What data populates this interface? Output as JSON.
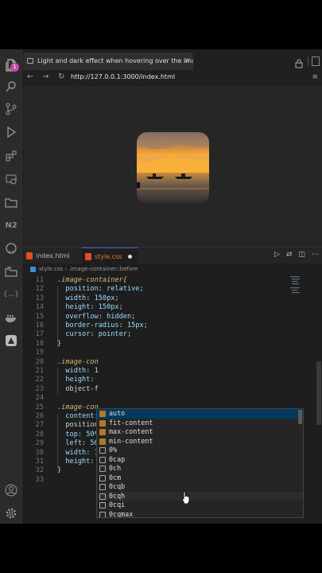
{
  "activity_bar": {
    "icons": [
      "explorer-icon",
      "search-icon",
      "source-control-icon",
      "run-debug-icon",
      "extensions-icon",
      "remote-explorer-icon",
      "folder-icon",
      "n2-icon",
      "github-icon",
      "folders-icon",
      "ellipsis-icon",
      "docker-icon",
      "azure-icon",
      "account-icon",
      "settings-icon"
    ],
    "badge": "1",
    "n2_label": "N2",
    "ellipsis_label": "{...}"
  },
  "browser": {
    "tab_title": "Light and dark effect when hovering over the image",
    "tab_close": "×",
    "url": "http://127.0.0.1:3000/index.html",
    "back": "←",
    "forward": "→",
    "reload": "↻",
    "menu": "≡"
  },
  "editor": {
    "tabs": [
      {
        "label": "index.html",
        "icon_color": "#e44d26",
        "active": false
      },
      {
        "label": "style.css",
        "icon_color": "#e44d26",
        "active": true,
        "dirty": true
      }
    ],
    "breadcrumb": {
      "file": "style.css",
      "separator": "›",
      "symbol": ".image-container::before"
    },
    "lines": [
      {
        "n": "11",
        "code": ".image-container{"
      },
      {
        "n": "12",
        "code": "  position: relative;"
      },
      {
        "n": "13",
        "code": "  width: 150px;"
      },
      {
        "n": "14",
        "code": "  height: 150px;"
      },
      {
        "n": "15",
        "code": "  overflow: hidden;"
      },
      {
        "n": "16",
        "code": "  border-radius: 15px;"
      },
      {
        "n": "17",
        "code": "  cursor: pointer;"
      },
      {
        "n": "18",
        "code": "}"
      },
      {
        "n": "19",
        "code": ""
      },
      {
        "n": "20",
        "code": ".image-con"
      },
      {
        "n": "21",
        "code": "  width: 1"
      },
      {
        "n": "22",
        "code": "  height: "
      },
      {
        "n": "23",
        "code": "  object-f"
      },
      {
        "n": "24",
        "code": ""
      },
      {
        "n": "25",
        "code": ".image-con"
      },
      {
        "n": "26",
        "code": "  content:"
      },
      {
        "n": "27",
        "code": "  position"
      },
      {
        "n": "28",
        "code": "  top: 50%"
      },
      {
        "n": "29",
        "code": "  left: 50"
      },
      {
        "n": "30",
        "code": "  width: 1"
      },
      {
        "n": "31",
        "code": "  height: ;"
      },
      {
        "n": "32",
        "code": "}"
      },
      {
        "n": "33",
        "code": ""
      }
    ],
    "suggestions": [
      {
        "label": "auto",
        "kind": "kw"
      },
      {
        "label": "fit-content",
        "kind": "kw"
      },
      {
        "label": "max-content",
        "kind": "kw"
      },
      {
        "label": "min-content",
        "kind": "kw"
      },
      {
        "label": "0%",
        "kind": "unit"
      },
      {
        "label": "0cap",
        "kind": "unit"
      },
      {
        "label": "0ch",
        "kind": "unit"
      },
      {
        "label": "0cm",
        "kind": "unit"
      },
      {
        "label": "0cqb",
        "kind": "unit"
      },
      {
        "label": "0cqh",
        "kind": "unit"
      },
      {
        "label": "0cqi",
        "kind": "unit"
      },
      {
        "label": "0cqmax",
        "kind": "unit"
      }
    ]
  },
  "colors": {
    "selector": "#d7ba7d",
    "property": "#9cdcfe",
    "value": "#ce9178",
    "number": "#b5cea8",
    "active_tab": "#e37933"
  }
}
